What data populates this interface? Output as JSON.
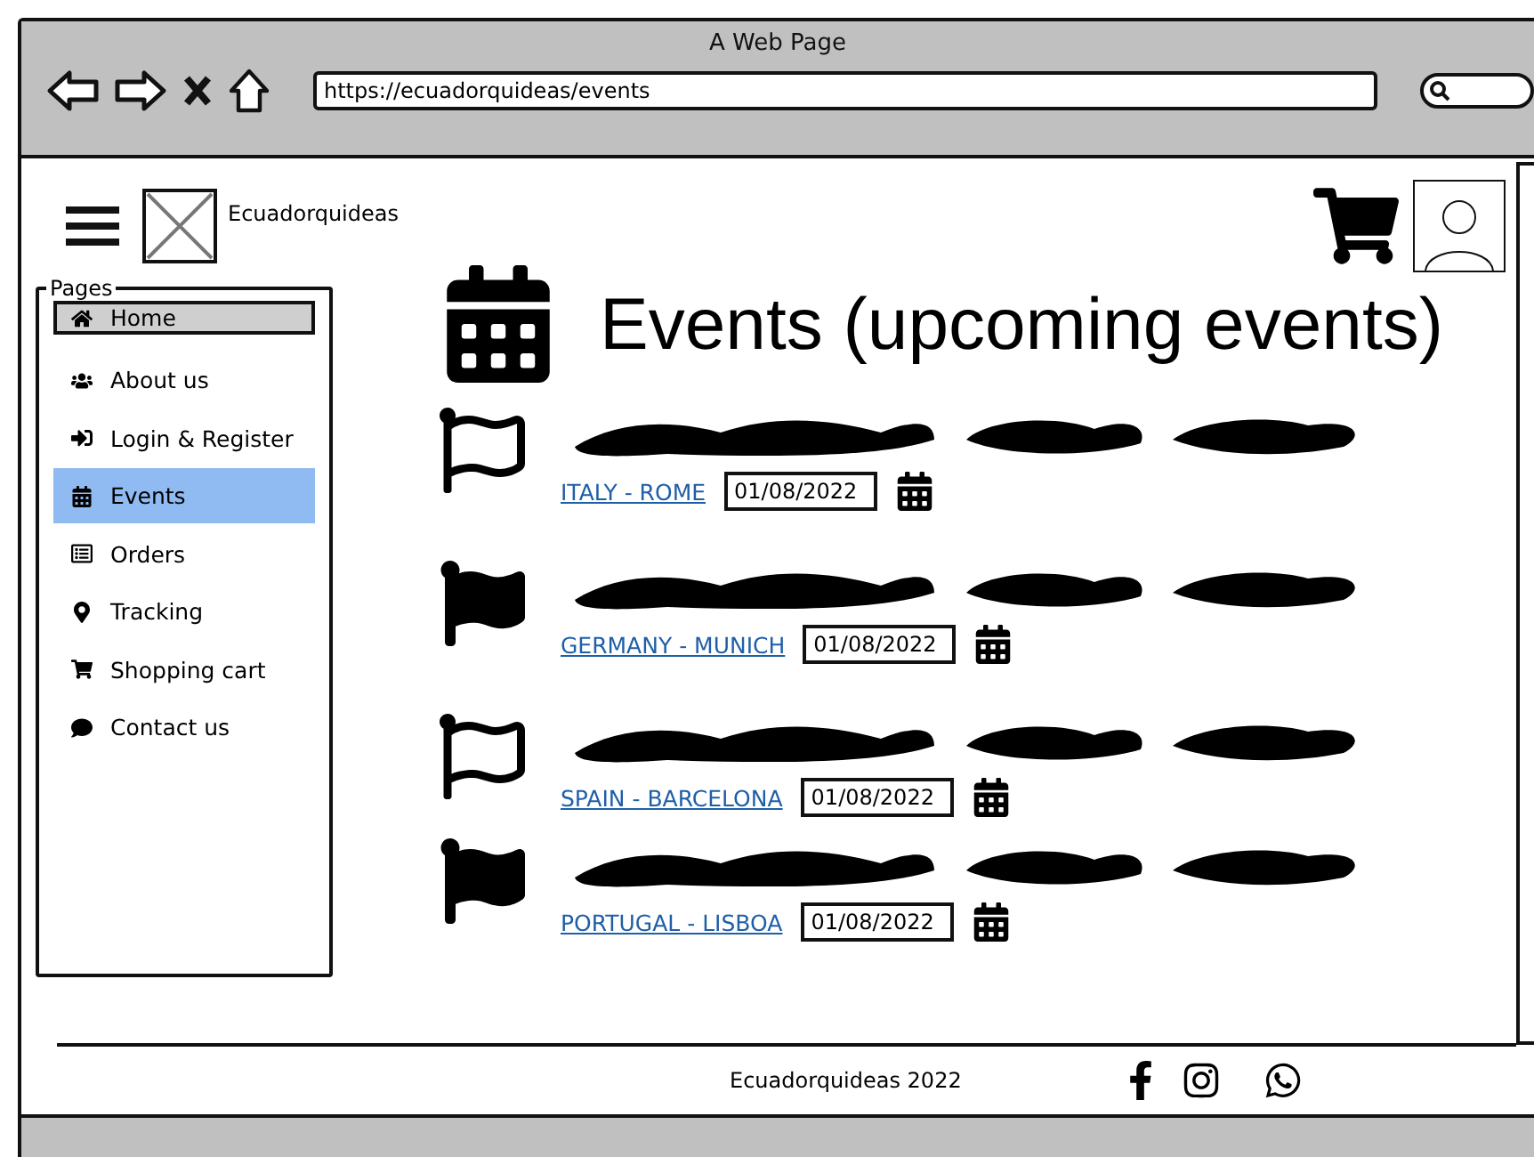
{
  "browser": {
    "title": "A Web Page",
    "url": "https://ecuadorquideas/events"
  },
  "header": {
    "brand": "Ecuadorquideas"
  },
  "sidebar": {
    "title": "Pages",
    "items": [
      {
        "label": "Home",
        "kind": "home",
        "selected": false,
        "boxed": true
      },
      {
        "label": "About us",
        "kind": "users",
        "selected": false,
        "boxed": false
      },
      {
        "label": "Login & Register",
        "kind": "login",
        "selected": false,
        "boxed": false
      },
      {
        "label": "Events",
        "kind": "calendar",
        "selected": true,
        "boxed": false
      },
      {
        "label": "Orders",
        "kind": "list",
        "selected": false,
        "boxed": false
      },
      {
        "label": "Tracking",
        "kind": "pin",
        "selected": false,
        "boxed": false
      },
      {
        "label": "Shopping cart",
        "kind": "cart",
        "selected": false,
        "boxed": false
      },
      {
        "label": "Contact us",
        "kind": "chat",
        "selected": false,
        "boxed": false
      }
    ]
  },
  "heading": "Events (upcoming events)",
  "events": [
    {
      "location": "ITALY - ROME",
      "date": "01/08/2022",
      "flag_filled": false
    },
    {
      "location": "GERMANY - MUNICH",
      "date": "01/08/2022",
      "flag_filled": true
    },
    {
      "location": "SPAIN - BARCELONA",
      "date": "01/08/2022",
      "flag_filled": false
    },
    {
      "location": "PORTUGAL - LISBOA",
      "date": "01/08/2022",
      "flag_filled": true
    }
  ],
  "footer": {
    "text": "Ecuadorquideas 2022"
  }
}
